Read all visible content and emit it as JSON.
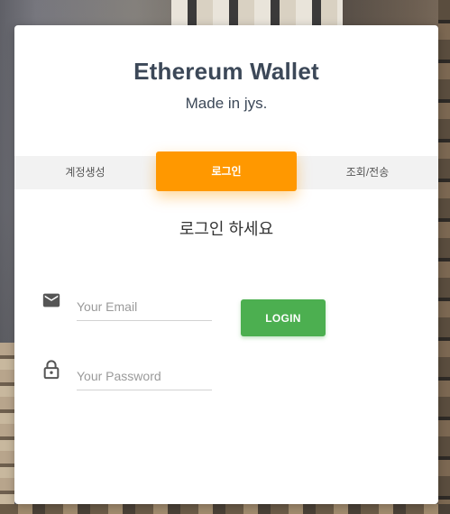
{
  "header": {
    "title": "Ethereum Wallet",
    "subtitle": "Made in jys."
  },
  "tabs": [
    {
      "label": "계정생성",
      "active": false
    },
    {
      "label": "로그인",
      "active": true
    },
    {
      "label": "조회/전송",
      "active": false
    }
  ],
  "login": {
    "prompt": "로그인 하세요",
    "email_placeholder": "Your Email",
    "password_placeholder": "Your Password",
    "button_label": "LOGIN",
    "email_icon": "envelope-icon",
    "password_icon": "lock-icon"
  },
  "colors": {
    "accent_tab": "#ff9800",
    "login_button": "#4caf50",
    "title_text": "#3c4858"
  }
}
